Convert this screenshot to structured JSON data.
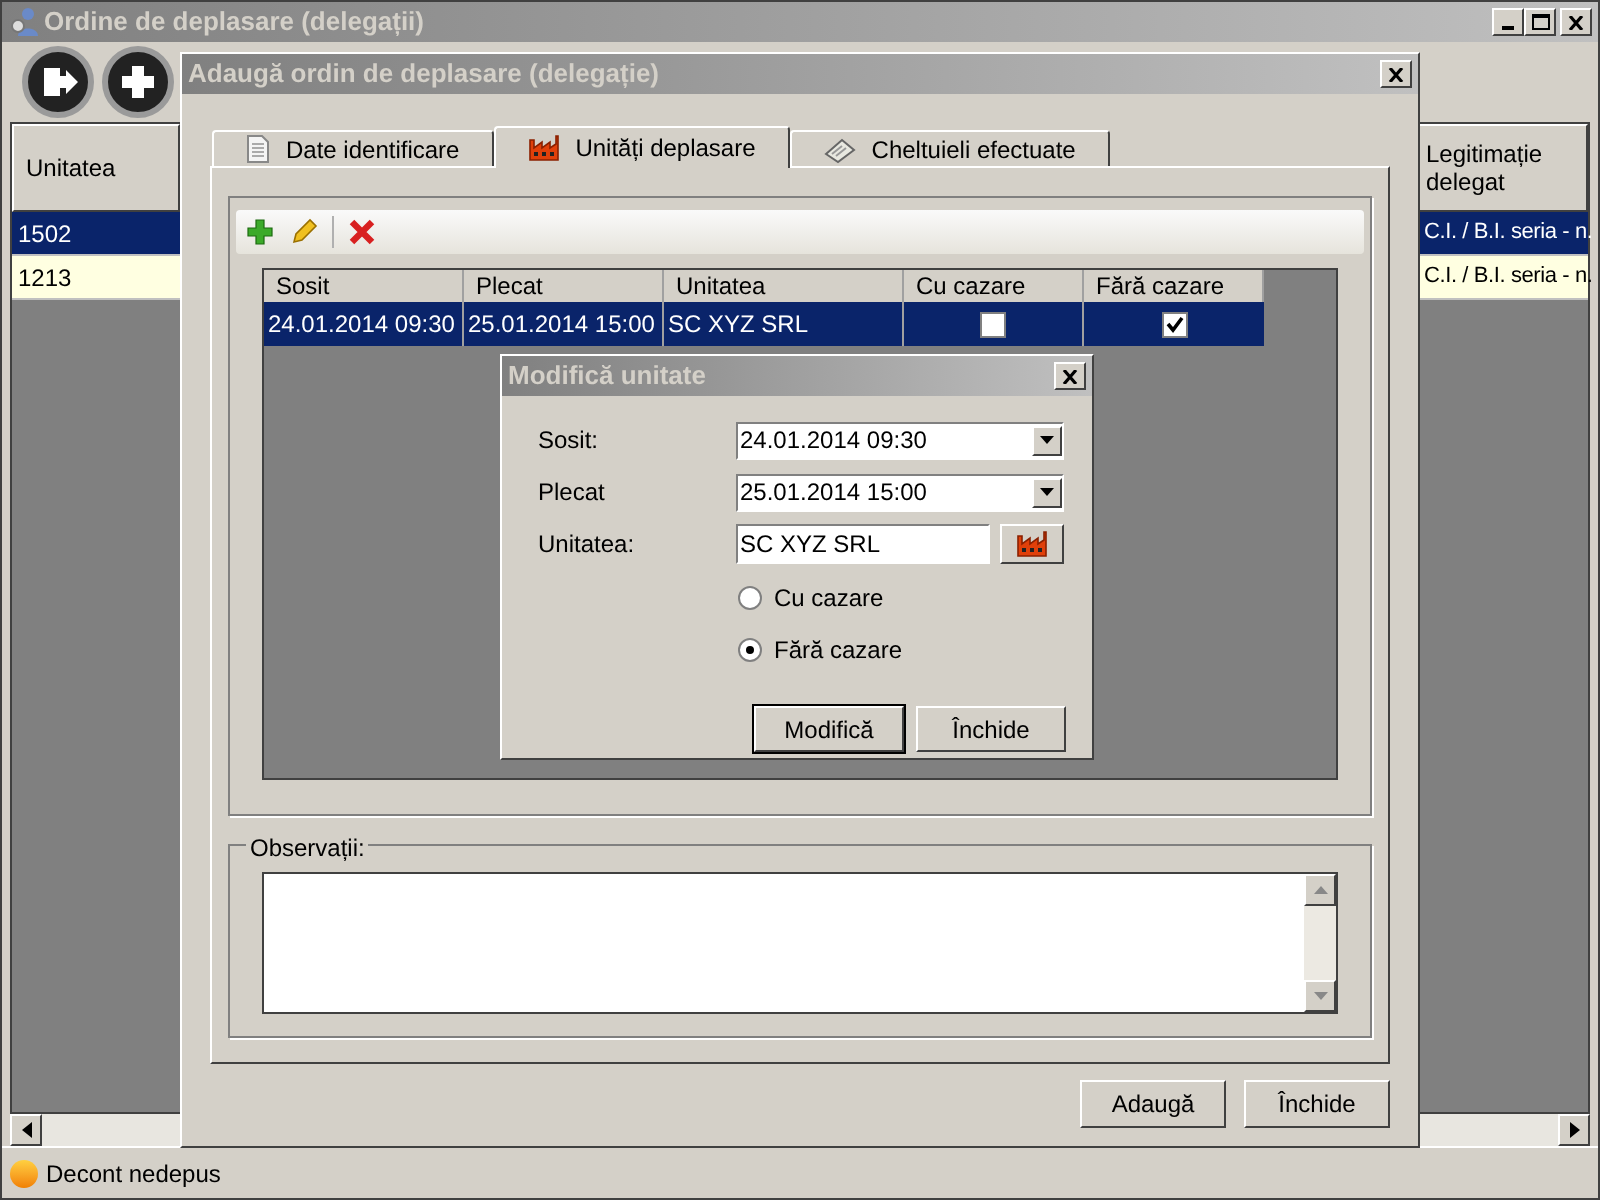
{
  "main_window": {
    "title": "Ordine de deplasare (delegații)",
    "grid": {
      "columns": [
        "Unitatea",
        "Legitimație delegat"
      ],
      "rows": [
        {
          "cells": [
            "1502",
            "C.I. / B.I. seria - n."
          ],
          "selected": true
        },
        {
          "cells": [
            "1213",
            "C.I. / B.I. seria - n."
          ],
          "selected": false
        }
      ]
    },
    "status_bar": {
      "text": "Decont nedepus"
    }
  },
  "dialog": {
    "title": "Adaugă ordin de deplasare (delegație)",
    "tabs": [
      {
        "label": "Date identificare",
        "selected": false
      },
      {
        "label": "Unități deplasare",
        "selected": true
      },
      {
        "label": "Cheltuieli efectuate",
        "selected": false
      }
    ],
    "grid": {
      "columns": [
        "Sosit",
        "Plecat",
        "Unitatea",
        "Cu cazare",
        "Fără cazare"
      ],
      "rows": [
        {
          "sosit": "24.01.2014 09:30",
          "plecat": "25.01.2014 15:00",
          "unitatea": "SC XYZ SRL",
          "cu_cazare": false,
          "fara_cazare": true,
          "selected": true
        }
      ]
    },
    "observatii": {
      "label": "Observații:"
    },
    "buttons": [
      "Adaugă",
      "Închide"
    ]
  },
  "edit_dialog": {
    "title": "Modifică unitate",
    "fields": [
      {
        "label": "Sosit:",
        "value": "24.01.2014 09:30",
        "kind": "dropdown"
      },
      {
        "label": "Plecat",
        "value": "25.01.2014 15:00",
        "kind": "dropdown"
      },
      {
        "label": "Unitatea:",
        "value": "SC XYZ SRL",
        "kind": "lookup"
      }
    ],
    "radios": [
      {
        "label": "Cu cazare",
        "selected": false
      },
      {
        "label": "Fără cazare",
        "selected": true
      }
    ],
    "buttons": [
      {
        "label": "Modifică",
        "default": true
      },
      {
        "label": "Închide",
        "default": false
      }
    ]
  }
}
